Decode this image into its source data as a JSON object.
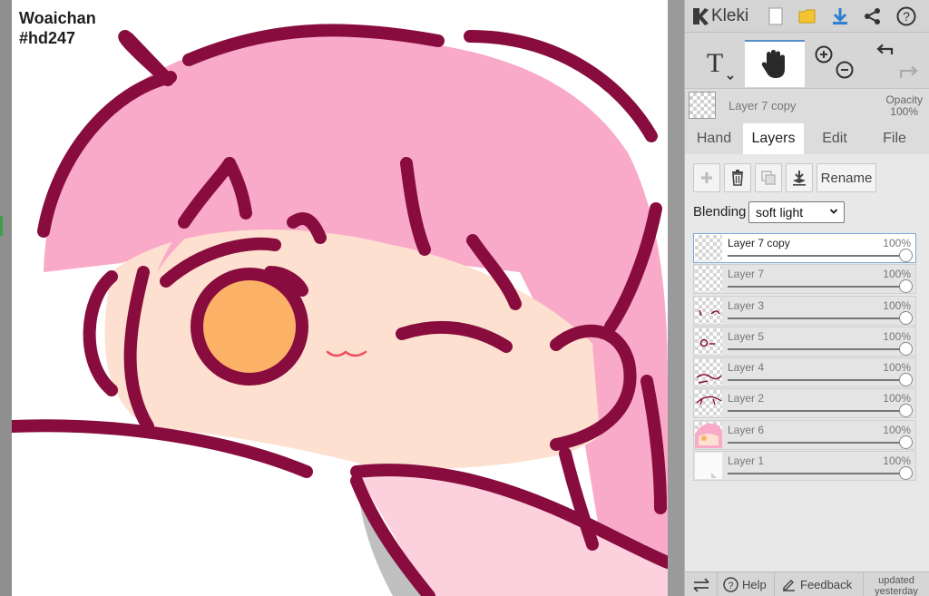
{
  "canvas": {
    "watermark_line1": "Woaichan",
    "watermark_line2": "#hd247"
  },
  "header": {
    "app_name": "Kleki",
    "icons": [
      "kleki-logo-icon",
      "new-file-icon",
      "open-folder-icon",
      "download-icon",
      "share-icon",
      "help-icon"
    ]
  },
  "toolbar": {
    "tools": [
      "text-tool-icon",
      "hand-tool-icon",
      "zoom-in-icon",
      "zoom-out-icon",
      "undo-icon",
      "redo-icon"
    ],
    "active_tool": "hand"
  },
  "current_layer": {
    "name": "Layer 7 copy",
    "opacity_label": "Opacity",
    "opacity_value": "100%"
  },
  "tabs": [
    {
      "label": "Hand",
      "active": false
    },
    {
      "label": "Layers",
      "active": true
    },
    {
      "label": "Edit",
      "active": false
    },
    {
      "label": "File",
      "active": false
    }
  ],
  "layers_panel": {
    "rename_label": "Rename",
    "blending_label": "Blending",
    "blending_value": "soft light",
    "layers": [
      {
        "name": "Layer 7 copy",
        "opacity": "100%",
        "active": true
      },
      {
        "name": "Layer 7",
        "opacity": "100%",
        "active": false
      },
      {
        "name": "Layer 3",
        "opacity": "100%",
        "active": false
      },
      {
        "name": "Layer 5",
        "opacity": "100%",
        "active": false
      },
      {
        "name": "Layer 4",
        "opacity": "100%",
        "active": false
      },
      {
        "name": "Layer 2",
        "opacity": "100%",
        "active": false
      },
      {
        "name": "Layer 6",
        "opacity": "100%",
        "active": false
      },
      {
        "name": "Layer 1",
        "opacity": "100%",
        "active": false
      }
    ]
  },
  "footer": {
    "help_label": "Help",
    "feedback_label": "Feedback",
    "updated_line1": "updated",
    "updated_line2": "yesterday"
  },
  "colors": {
    "accent_blue": "#2f7fd1",
    "folder_yellow": "#f4c430",
    "hair_pink": "#f9aac8",
    "outline_maroon": "#880d3e",
    "skin": "#fde0d0",
    "eye_orange": "#fbb266"
  }
}
